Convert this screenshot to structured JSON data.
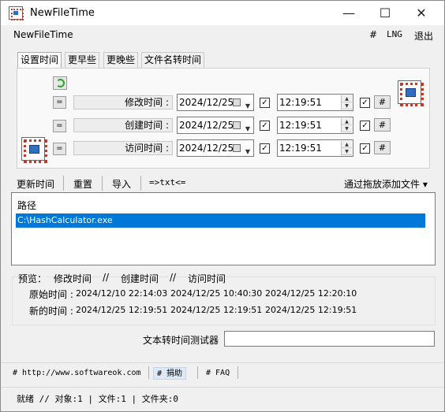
{
  "window": {
    "title": "NewFileTime",
    "minimize": "—",
    "maximize": "☐",
    "close": "✕"
  },
  "menubar": {
    "app_label": "NewFileTime",
    "hash": "#",
    "lng": "LNG",
    "exit": "退出"
  },
  "tabs": [
    "设置时间",
    "更早些",
    "更晚些",
    "文件名转时间"
  ],
  "rows": [
    {
      "eq": "=",
      "label": "修改时间 :",
      "date": "2024/12/25",
      "date_checked": true,
      "time": "12:19:51",
      "time_checked": true,
      "hash": "#"
    },
    {
      "eq": "=",
      "label": "创建时间 :",
      "date": "2024/12/25",
      "date_checked": true,
      "time": "12:19:51",
      "time_checked": true,
      "hash": "#"
    },
    {
      "eq": "=",
      "label": "访问时间 :",
      "date": "2024/12/25",
      "date_checked": true,
      "time": "12:19:51",
      "time_checked": true,
      "hash": "#"
    }
  ],
  "toolbar": {
    "update": "更新时间",
    "reset": "重置",
    "import": "导入",
    "txt": "=>txt<=",
    "drag": "通过拖放添加文件 ▾"
  },
  "list": {
    "header": "路径",
    "items": [
      "C:\\HashCalculator.exe"
    ]
  },
  "preview": {
    "header": {
      "label": "预览：",
      "c1": "修改时间",
      "s1": "//",
      "c2": "创建时间",
      "s2": "//",
      "c3": "访问时间"
    },
    "original_label": "原始时间 :",
    "original": [
      "2024/12/10 22:14:03",
      "2024/12/25 10:40:30",
      "2024/12/25 12:20:10"
    ],
    "new_label": "新的时间 :",
    "new": [
      "2024/12/25 12:19:51",
      "2024/12/25 12:19:51",
      "2024/12/25 12:19:51"
    ]
  },
  "tester": {
    "label": "文本转时间测试器",
    "value": ""
  },
  "links": {
    "website": "# http://www.softwareok.com",
    "donate": "# 捐助",
    "faq": "# FAQ"
  },
  "status": "就绪 // 对象:1 | 文件:1  | 文件夹:0",
  "colors": {
    "selection": "#0078d7",
    "window_bg": "#f0f0f0"
  }
}
